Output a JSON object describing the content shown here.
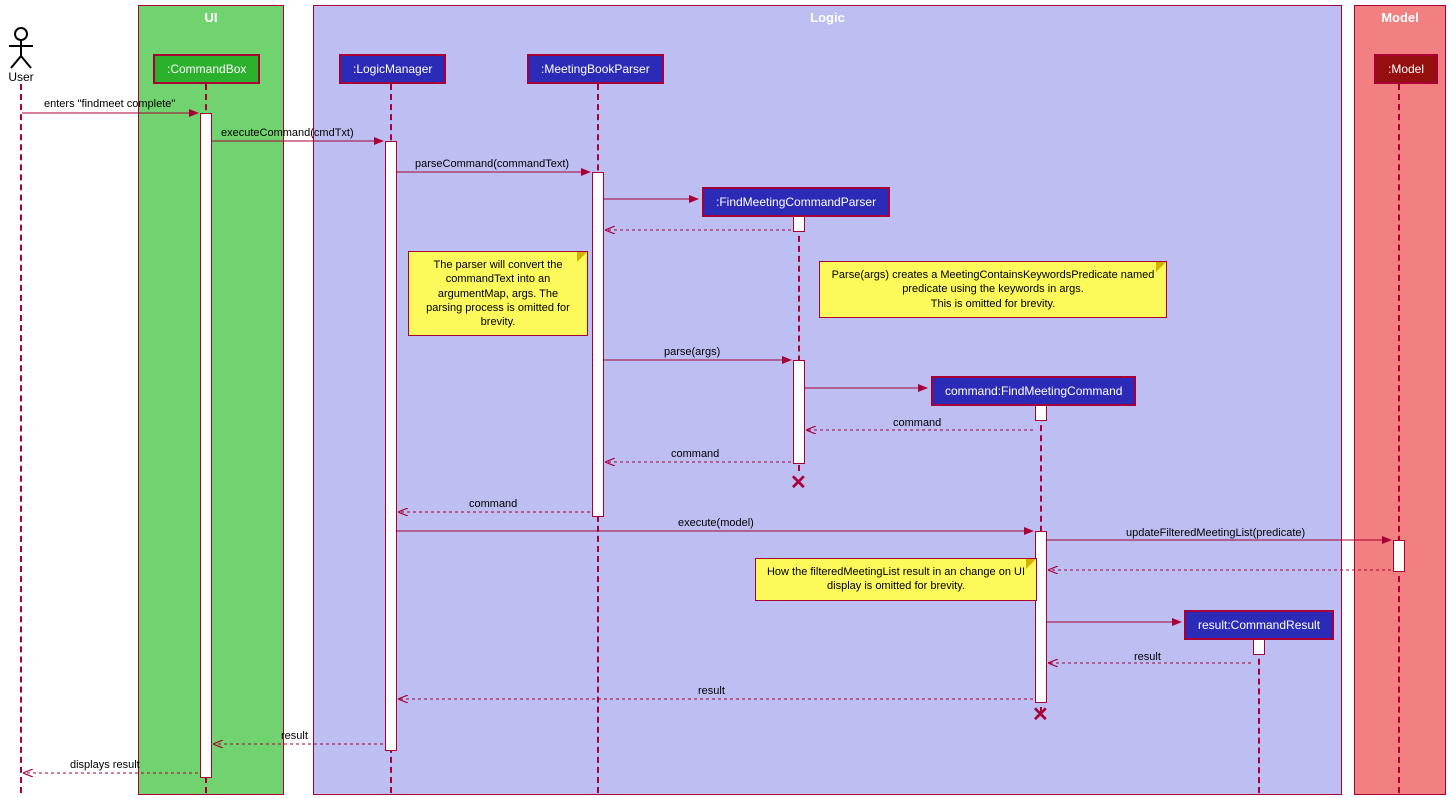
{
  "actor": {
    "label": "User"
  },
  "containers": {
    "ui": {
      "title": "UI"
    },
    "logic": {
      "title": "Logic"
    },
    "model": {
      "title": "Model"
    }
  },
  "participants": {
    "commandBox": ":CommandBox",
    "logicManager": ":LogicManager",
    "meetingBookParser": ":MeetingBookParser",
    "findMeetingCommandParser": ":FindMeetingCommandParser",
    "findMeetingCommand": "command:FindMeetingCommand",
    "commandResult": "result:CommandResult",
    "model": ":Model"
  },
  "messages": {
    "m1": "enters \"findmeet complete\"",
    "m2": "executeCommand(cmdTxt)",
    "m3": "parseCommand(commandText)",
    "m4": "parse(args)",
    "m5": "command",
    "m6": "command",
    "m7": "command",
    "m8": "execute(model)",
    "m9": "updateFilteredMeetingList(predicate)",
    "m10": "result",
    "m11": "result",
    "m12": "result",
    "m13": "displays result"
  },
  "notes": {
    "n1": "The parser will convert the commandText into an argumentMap, args. The parsing process is omitted for brevity.",
    "n2": "Parse(args) creates a MeetingContainsKeywordsPredicate named predicate using the keywords in args.\nThis is omitted for brevity.",
    "n3": "How the filteredMeetingList result in an change on UI display is omitted for brevity."
  }
}
